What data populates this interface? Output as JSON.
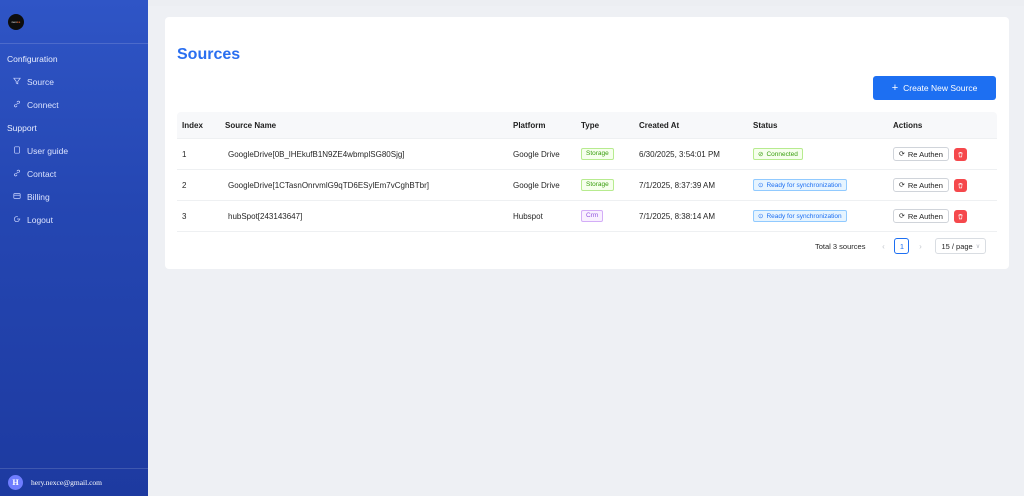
{
  "logo": {
    "text_prefix": "nex",
    "text_suffix": "ce"
  },
  "sidebar": {
    "sections": [
      {
        "title": "Configuration",
        "items": [
          {
            "label": "Source",
            "icon": "funnel-icon"
          },
          {
            "label": "Connect",
            "icon": "link-icon"
          }
        ]
      },
      {
        "title": "Support",
        "items": [
          {
            "label": "User guide",
            "icon": "book-icon"
          },
          {
            "label": "Contact",
            "icon": "link-icon"
          },
          {
            "label": "Billing",
            "icon": "credit-card-icon"
          },
          {
            "label": "Logout",
            "icon": "logout-icon"
          }
        ]
      }
    ]
  },
  "user": {
    "initial": "H",
    "email": "hery.nexce@gmail.com"
  },
  "page": {
    "title": "Sources",
    "create_label": "Create New Source"
  },
  "table": {
    "headers": {
      "index": "Index",
      "name": "Source Name",
      "platform": "Platform",
      "type": "Type",
      "created": "Created At",
      "status": "Status",
      "actions": "Actions"
    },
    "rows": [
      {
        "index": "1",
        "name": "GoogleDrive[0B_lHEkufB1N9ZE4wbmplSG80Sjg]",
        "platform": "Google Drive",
        "type": "Storage",
        "created": "6/30/2025, 3:54:01 PM",
        "status": "Connected",
        "status_kind": "connected",
        "reauth": "Re Authen"
      },
      {
        "index": "2",
        "name": "GoogleDrive[1CTasnOnrvmlG9qTD6ESylEm7vCghBTbr]",
        "platform": "Google Drive",
        "type": "Storage",
        "created": "7/1/2025, 8:37:39 AM",
        "status": "Ready for synchronization",
        "status_kind": "ready",
        "reauth": "Re Authen"
      },
      {
        "index": "3",
        "name": "hubSpot[243143647]",
        "platform": "Hubspot",
        "type": "Crm",
        "created": "7/1/2025, 8:38:14 AM",
        "status": "Ready for synchronization",
        "status_kind": "ready",
        "reauth": "Re Authen"
      }
    ]
  },
  "pagination": {
    "total": "Total 3 sources",
    "current_page": "1",
    "page_size": "15 / page"
  },
  "colors": {
    "accent": "#1d6ff2",
    "sidebar": "#2547b3",
    "danger": "#f5484c"
  }
}
